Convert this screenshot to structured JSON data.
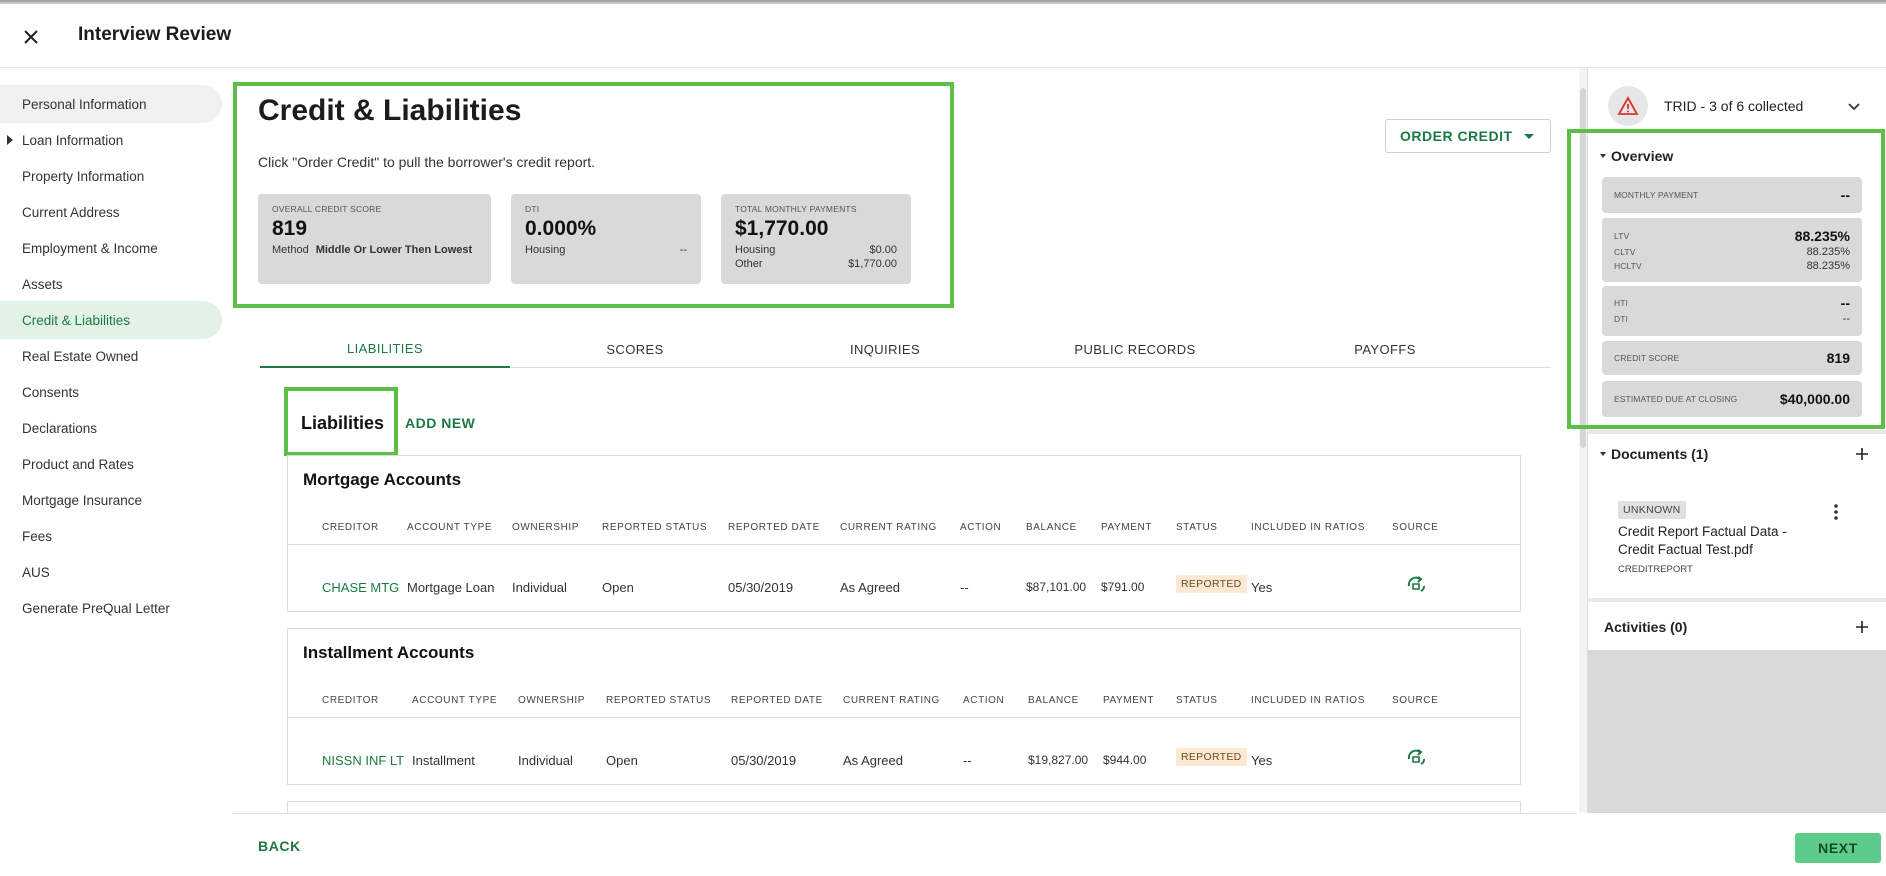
{
  "header": {
    "title": "Interview Review",
    "close_icon": "close-icon"
  },
  "sidebar": {
    "items": [
      {
        "label": "Personal Information"
      },
      {
        "label": "Loan Information"
      },
      {
        "label": "Property Information"
      },
      {
        "label": "Current Address"
      },
      {
        "label": "Employment & Income"
      },
      {
        "label": "Assets"
      },
      {
        "label": "Credit & Liabilities"
      },
      {
        "label": "Real Estate Owned"
      },
      {
        "label": "Consents"
      },
      {
        "label": "Declarations"
      },
      {
        "label": "Product and Rates"
      },
      {
        "label": "Mortgage Insurance"
      },
      {
        "label": "Fees"
      },
      {
        "label": "AUS"
      },
      {
        "label": "Generate PreQual Letter"
      }
    ],
    "active_index": 6
  },
  "main": {
    "title": "Credit & Liabilities",
    "subtitle": "Click \"Order Credit\" to pull the borrower's credit report.",
    "order_credit_label": "ORDER CREDIT",
    "credit_card": {
      "label": "OVERALL CREDIT SCORE",
      "value": "819",
      "method_label": "Method",
      "method_value": "Middle Or Lower Then Lowest"
    },
    "dti_card": {
      "label": "DTI",
      "value": "0.000%",
      "housing_label": "Housing",
      "housing_value": "--"
    },
    "payments_card": {
      "label": "TOTAL MONTHLY PAYMENTS",
      "value": "$1,770.00",
      "housing_label": "Housing",
      "housing_value": "$0.00",
      "other_label": "Other",
      "other_value": "$1,770.00"
    },
    "tabs": [
      {
        "label": "LIABILITIES"
      },
      {
        "label": "SCORES"
      },
      {
        "label": "INQUIRIES"
      },
      {
        "label": "PUBLIC RECORDS"
      },
      {
        "label": "PAYOFFS"
      }
    ],
    "liabilities_title": "Liabilities",
    "add_new_label": "ADD NEW",
    "columns": [
      "CREDITOR",
      "ACCOUNT TYPE",
      "OWNERSHIP",
      "REPORTED STATUS",
      "REPORTED DATE",
      "CURRENT RATING",
      "ACTION",
      "BALANCE",
      "PAYMENT",
      "STATUS",
      "INCLUDED IN RATIOS",
      "SOURCE"
    ],
    "mortgage": {
      "title": "Mortgage Accounts",
      "row": {
        "creditor": "CHASE MTG",
        "account_type": "Mortgage Loan",
        "ownership": "Individual",
        "reported_status": "Open",
        "reported_date": "05/30/2019",
        "current_rating": "As Agreed",
        "action": "--",
        "balance": "$87,101.00",
        "payment": "$791.00",
        "status": "REPORTED",
        "included": "Yes"
      }
    },
    "installment": {
      "title": "Installment Accounts",
      "row": {
        "creditor": "NISSN INF LT",
        "account_type": "Installment",
        "ownership": "Individual",
        "reported_status": "Open",
        "reported_date": "05/30/2019",
        "current_rating": "As Agreed",
        "action": "--",
        "balance": "$19,827.00",
        "payment": "$944.00",
        "status": "REPORTED",
        "included": "Yes"
      }
    }
  },
  "footer": {
    "back_label": "BACK",
    "next_label": "NEXT"
  },
  "right_panel": {
    "trid_label": "TRID - 3 of 6 collected",
    "overview": {
      "title": "Overview",
      "monthly_payment_label": "MONTHLY PAYMENT",
      "monthly_payment_value": "--",
      "ltv_label": "LTV",
      "ltv_value": "88.235%",
      "cltv_label": "CLTV",
      "cltv_value": "88.235%",
      "hcltv_label": "HCLTV",
      "hcltv_value": "88.235%",
      "hti_label": "HTI",
      "hti_value": "--",
      "dti_label": "DTI",
      "dti_value": "--",
      "credit_score_label": "CREDIT SCORE",
      "credit_score_value": "819",
      "due_label": "ESTIMATED DUE AT CLOSING",
      "due_value": "$40,000.00"
    },
    "documents": {
      "title": "Documents (1)",
      "badge": "UNKNOWN",
      "name": "Credit Report Factual Data - Credit Factual Test.pdf",
      "type": "CREDITREPORT"
    },
    "activities": {
      "title": "Activities (0)"
    }
  },
  "colors": {
    "accent": "#1b7a44",
    "highlight": "#5dc046",
    "next_button": "#5ecb8a",
    "badge_reported": "#fbe9d4"
  }
}
